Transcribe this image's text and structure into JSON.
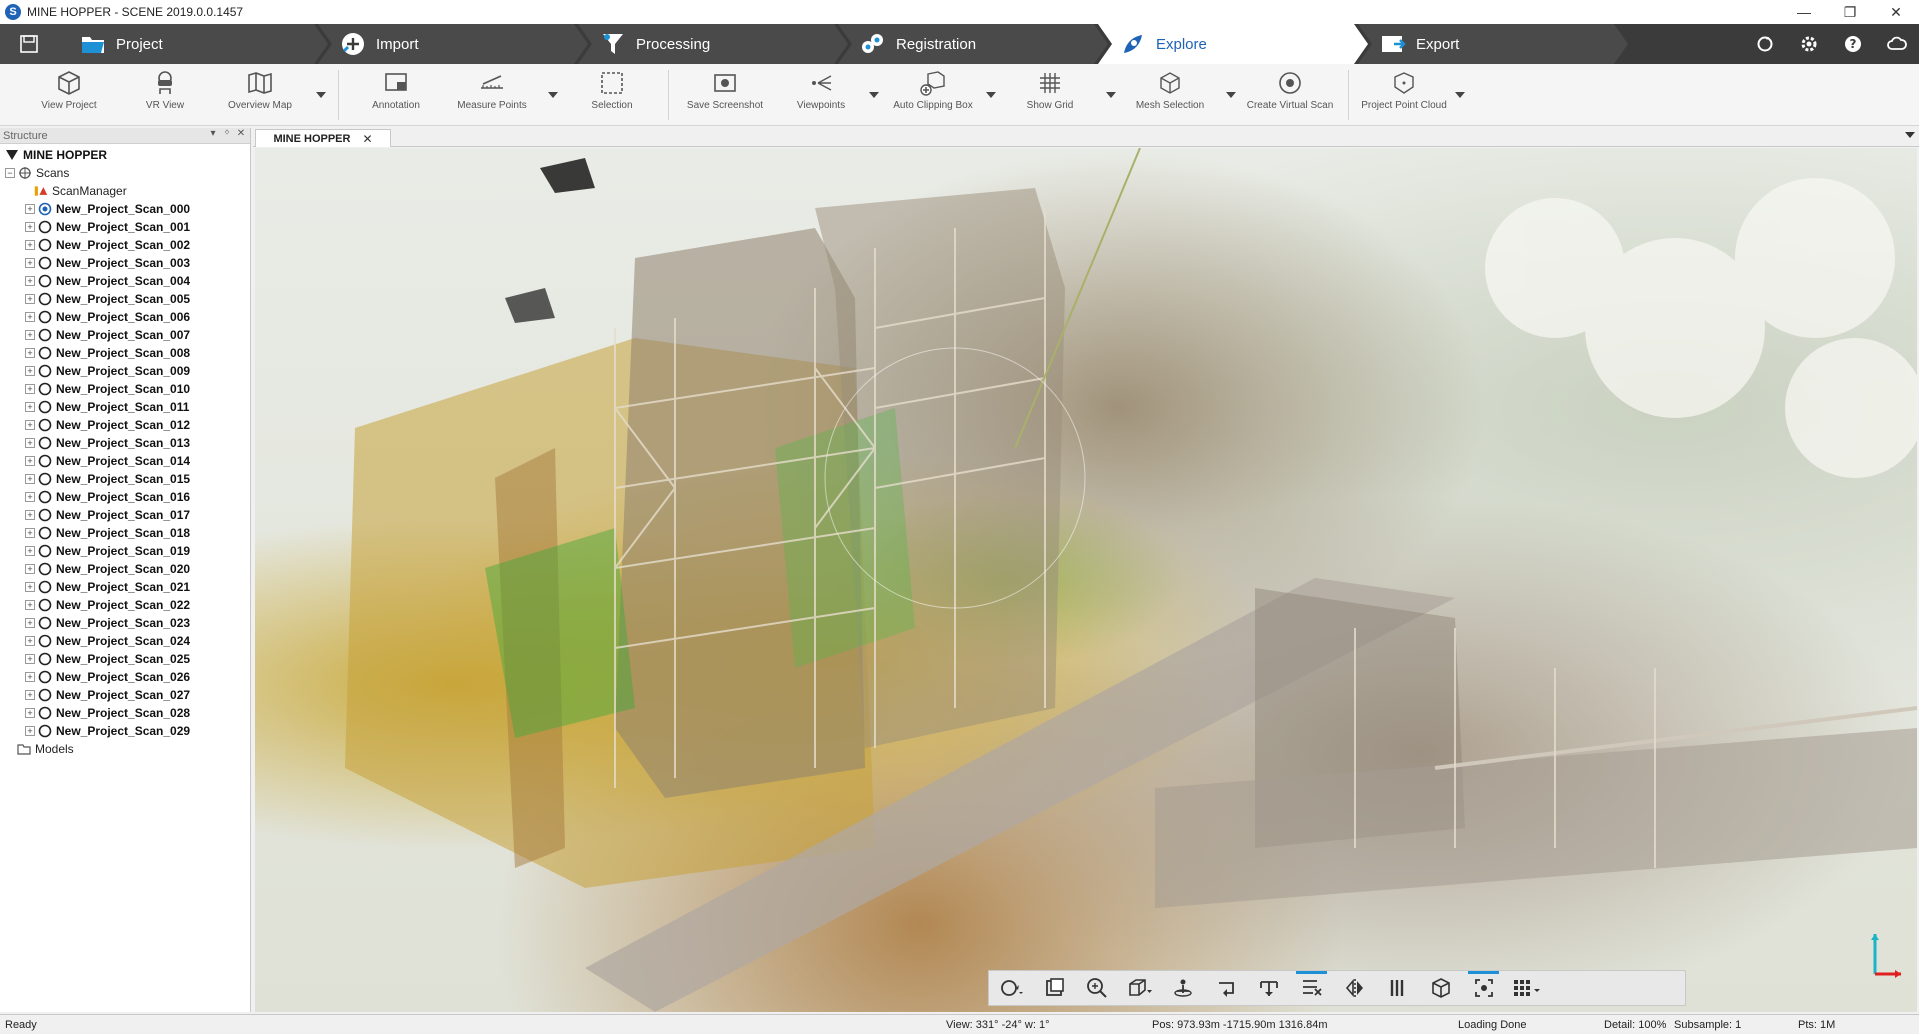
{
  "window": {
    "app_icon_letter": "S",
    "title": "MINE HOPPER - SCENE 2019.0.0.1457",
    "controls": [
      "—",
      "❐",
      "✕"
    ]
  },
  "tabs": [
    {
      "label": "Project",
      "icon": "folder-icon",
      "active": false
    },
    {
      "label": "Import",
      "icon": "import-icon",
      "active": false
    },
    {
      "label": "Processing",
      "icon": "processing-icon",
      "active": false
    },
    {
      "label": "Registration",
      "icon": "registration-icon",
      "active": false
    },
    {
      "label": "Explore",
      "icon": "explore-icon",
      "active": true
    },
    {
      "label": "Export",
      "icon": "export-icon",
      "active": false
    }
  ],
  "toolbar": {
    "items": [
      {
        "label": "View Project",
        "icon": "cube-icon"
      },
      {
        "label": "VR View",
        "icon": "vr-headset-icon"
      },
      {
        "label": "Overview Map",
        "icon": "map-icon"
      },
      {
        "label": "Annotation",
        "icon": "annotation-icon"
      },
      {
        "label": "Measure Points",
        "icon": "measure-points-icon"
      },
      {
        "label": "Selection",
        "icon": "selection-icon"
      },
      {
        "label": "Save Screenshot",
        "icon": "screenshot-icon"
      },
      {
        "label": "Viewpoints",
        "icon": "viewpoints-icon"
      },
      {
        "label": "Auto Clipping Box",
        "icon": "clipping-box-icon"
      },
      {
        "label": "Show Grid",
        "icon": "grid-icon"
      },
      {
        "label": "Mesh Selection",
        "icon": "mesh-selection-icon"
      },
      {
        "label": "Create Virtual Scan",
        "icon": "virtual-scan-icon"
      },
      {
        "label": "Project Point Cloud",
        "icon": "point-cloud-icon"
      }
    ]
  },
  "structure": {
    "title": "Structure",
    "header_controls": [
      "▾",
      "ᛜ",
      "✕"
    ],
    "root": "MINE HOPPER",
    "scans_label": "Scans",
    "scan_manager": "ScanManager",
    "scans": [
      "New_Project_Scan_000",
      "New_Project_Scan_001",
      "New_Project_Scan_002",
      "New_Project_Scan_003",
      "New_Project_Scan_004",
      "New_Project_Scan_005",
      "New_Project_Scan_006",
      "New_Project_Scan_007",
      "New_Project_Scan_008",
      "New_Project_Scan_009",
      "New_Project_Scan_010",
      "New_Project_Scan_011",
      "New_Project_Scan_012",
      "New_Project_Scan_013",
      "New_Project_Scan_014",
      "New_Project_Scan_015",
      "New_Project_Scan_016",
      "New_Project_Scan_017",
      "New_Project_Scan_018",
      "New_Project_Scan_019",
      "New_Project_Scan_020",
      "New_Project_Scan_021",
      "New_Project_Scan_022",
      "New_Project_Scan_023",
      "New_Project_Scan_024",
      "New_Project_Scan_025",
      "New_Project_Scan_026",
      "New_Project_Scan_027",
      "New_Project_Scan_028",
      "New_Project_Scan_029"
    ],
    "models_label": "Models"
  },
  "viewport": {
    "tab_label": "MINE HOPPER",
    "tab_close": "✕"
  },
  "status": {
    "ready": "Ready",
    "view": "View: 331° -24° w: 1°",
    "pos": "Pos: 973.93m -1715.90m 1316.84m",
    "loading": "Loading Done",
    "detail": "Detail: 100%",
    "subsample": "Subsample:  1",
    "pts": "Pts:   1M"
  },
  "colors": {
    "accent": "#1e63b5",
    "tab_bar": "#3b3b3b",
    "highlight": "#1e90d6"
  }
}
